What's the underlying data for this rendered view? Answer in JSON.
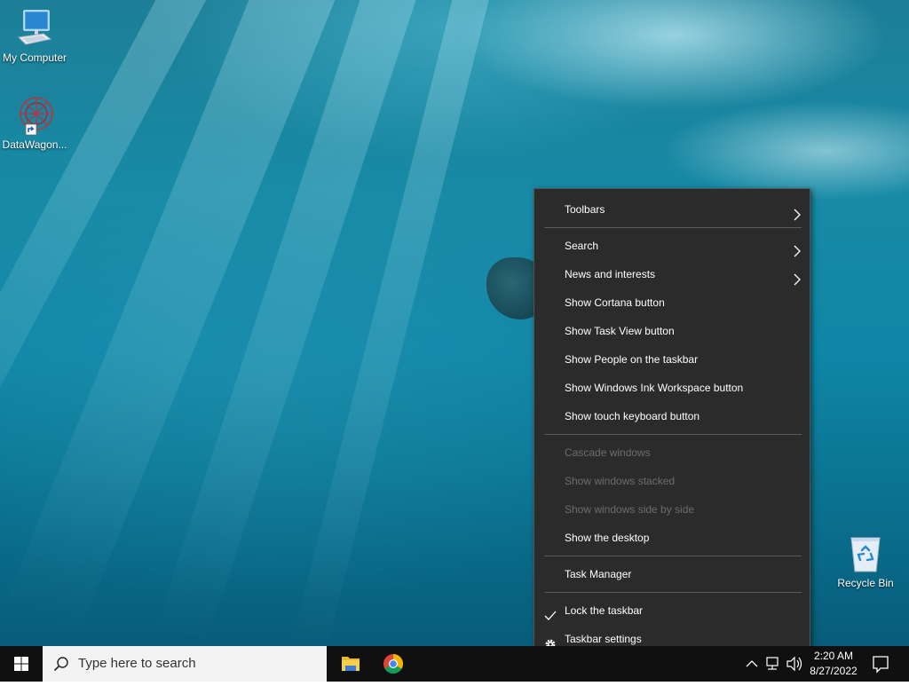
{
  "desktop": {
    "icons": [
      {
        "label": "My Computer",
        "icon": "computer-icon"
      },
      {
        "label": "DataWagon...",
        "icon": "datawagon-icon"
      },
      {
        "label": "Recycle Bin",
        "icon": "recycle-bin-icon"
      }
    ]
  },
  "context_menu": {
    "items": [
      {
        "label": "Toolbars",
        "submenu": true,
        "enabled": true
      },
      {
        "label": "Search",
        "submenu": true,
        "enabled": true
      },
      {
        "label": "News and interests",
        "submenu": true,
        "enabled": true
      },
      {
        "label": "Show Cortana button",
        "enabled": true
      },
      {
        "label": "Show Task View button",
        "enabled": true
      },
      {
        "label": "Show People on the taskbar",
        "enabled": true
      },
      {
        "label": "Show Windows Ink Workspace button",
        "enabled": true
      },
      {
        "label": "Show touch keyboard button",
        "enabled": true
      },
      {
        "label": "Cascade windows",
        "enabled": false
      },
      {
        "label": "Show windows stacked",
        "enabled": false
      },
      {
        "label": "Show windows side by side",
        "enabled": false
      },
      {
        "label": "Show the desktop",
        "enabled": true
      },
      {
        "label": "Task Manager",
        "enabled": true
      },
      {
        "label": "Lock the taskbar",
        "checked": true,
        "enabled": true
      },
      {
        "label": "Taskbar settings",
        "icon": "gear-icon",
        "enabled": true
      }
    ]
  },
  "taskbar": {
    "search_placeholder": "Type here to search",
    "apps": [
      {
        "name": "File Explorer",
        "icon": "folder-icon"
      },
      {
        "name": "Google Chrome",
        "icon": "chrome-icon"
      }
    ],
    "clock": {
      "time": "2:20 AM",
      "date": "8/27/2022"
    }
  },
  "colors": {
    "menu_bg": "#2b2b2b",
    "menu_disabled_text": "#6d6d6d",
    "taskbar_bg": "#101010",
    "search_bg": "#f3f3f3"
  }
}
